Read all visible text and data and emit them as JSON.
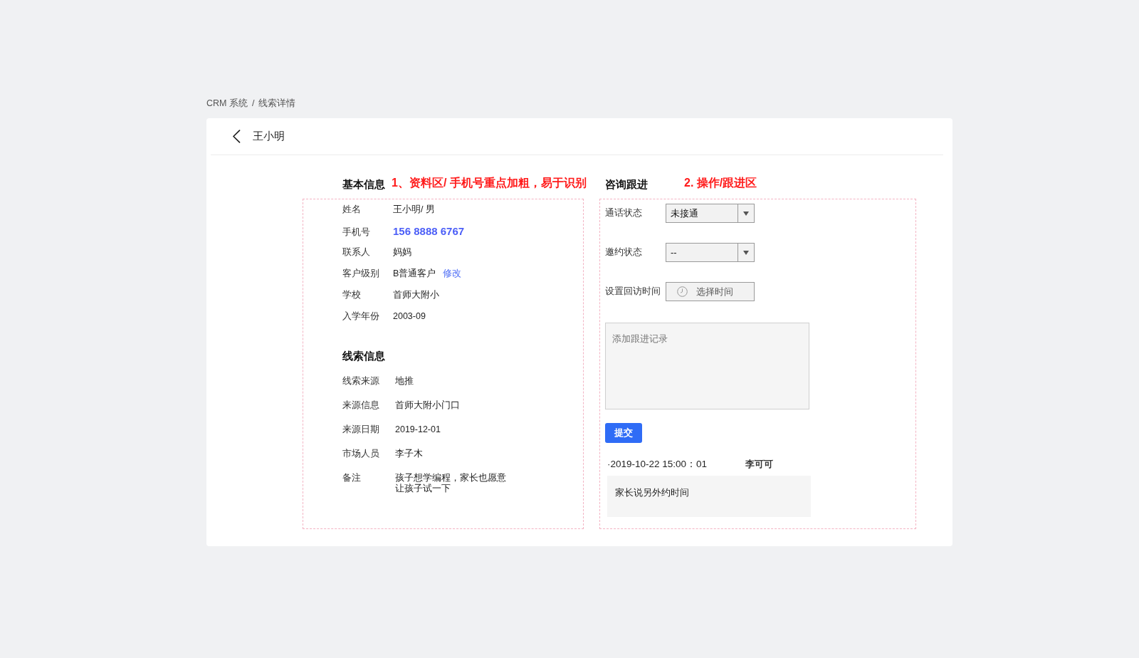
{
  "breadcrumb": {
    "items": [
      "CRM 系统",
      "线索详情"
    ],
    "separator": "/"
  },
  "header": {
    "title": "王小明"
  },
  "basic_info": {
    "title": "基本信息",
    "annotation": "1、资料区/ 手机号重点加粗，易于识别",
    "rows": [
      {
        "kind": "text",
        "label": "姓名",
        "value": "王小明/ 男"
      },
      {
        "kind": "phone",
        "label": "手机号",
        "value": "156 8888 6767"
      },
      {
        "kind": "text",
        "label": "联系人",
        "value": "妈妈"
      },
      {
        "kind": "text",
        "label": "客户级别",
        "value": "B普通客户",
        "action": "修改"
      },
      {
        "kind": "text",
        "label": "学校",
        "value": "首师大附小"
      },
      {
        "kind": "text",
        "label": "入学年份",
        "value": "2003-09"
      }
    ]
  },
  "lead_info": {
    "title": "线索信息",
    "rows": [
      {
        "label": "线索来源",
        "value": "地推"
      },
      {
        "label": "来源信息",
        "value": "首师大附小门口"
      },
      {
        "label": "来源日期",
        "value": "2019-12-01"
      },
      {
        "label": "市场人员",
        "value": "李子木"
      },
      {
        "label": "备注",
        "value": "孩子想学编程，家长也愿意让孩子试一下"
      }
    ]
  },
  "follow_up": {
    "title": "咨询跟进",
    "annotation": "2. 操作/跟进区",
    "fields": [
      {
        "kind": "select",
        "label": "通话状态",
        "value": "未接通"
      },
      {
        "kind": "select",
        "label": "邀约状态",
        "value": "--"
      },
      {
        "kind": "time",
        "label": "设置回访时间",
        "placeholder": "选择时间"
      }
    ],
    "record_field": {
      "placeholder": "添加跟进记录"
    },
    "submit_button": "提交",
    "records": [
      {
        "time": "·2019-10-22 15:00：01",
        "author": "李可可",
        "note": "家长说另外约时间"
      }
    ]
  }
}
